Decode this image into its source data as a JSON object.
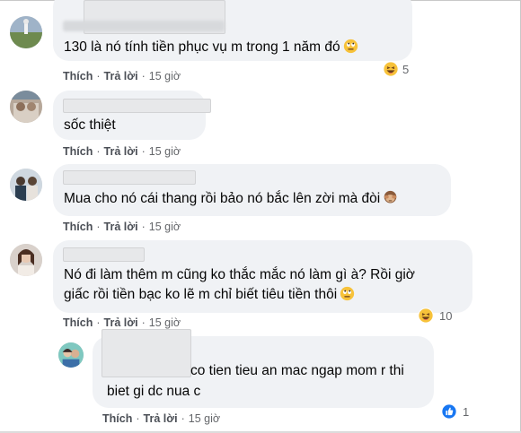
{
  "comments": [
    {
      "text": "130 là nó tính tiền phục vụ m trong 1 năm đó",
      "emoji": "rolling-eyes-emoji",
      "actions": {
        "like": "Thích",
        "reply": "Trả lời",
        "time": "15 giờ"
      },
      "reaction": {
        "icon": "laughing-reaction-icon",
        "count": "5"
      }
    },
    {
      "text": "sốc thiệt",
      "actions": {
        "like": "Thích",
        "reply": "Trả lời",
        "time": "15 giờ"
      }
    },
    {
      "text": "Mua cho nó cái thang rồi bảo nó bắc lên zời mà đòi",
      "emoji": "see-no-evil-monkey-emoji",
      "actions": {
        "like": "Thích",
        "reply": "Trả lời",
        "time": "15 giờ"
      }
    },
    {
      "line1": "Nó đi làm thêm m cũng ko thắc mắc nó làm gì à? Rồi giờ",
      "line2": "giấc rồi tiền bạc ko lẽ m chỉ biết tiêu tiền thôi",
      "emoji": "rolling-eyes-emoji",
      "actions": {
        "like": "Thích",
        "reply": "Trả lời",
        "time": "15 giờ"
      },
      "reaction": {
        "icon": "laughing-reaction-icon",
        "count": "10"
      }
    },
    {
      "line1": "co tien tieu an mac ngap mom r thi",
      "line2": "biet gi dc nua c",
      "actions": {
        "like": "Thích",
        "reply": "Trả lời",
        "time": "15 giờ"
      },
      "reaction": {
        "icon": "like-reaction-icon",
        "count": "1"
      }
    }
  ],
  "colors": {
    "bubble": "#f0f2f5",
    "text": "#050505",
    "meta": "#65676b",
    "like_blue": "#1877f2",
    "emoji_yellow": "#f7c23a"
  }
}
